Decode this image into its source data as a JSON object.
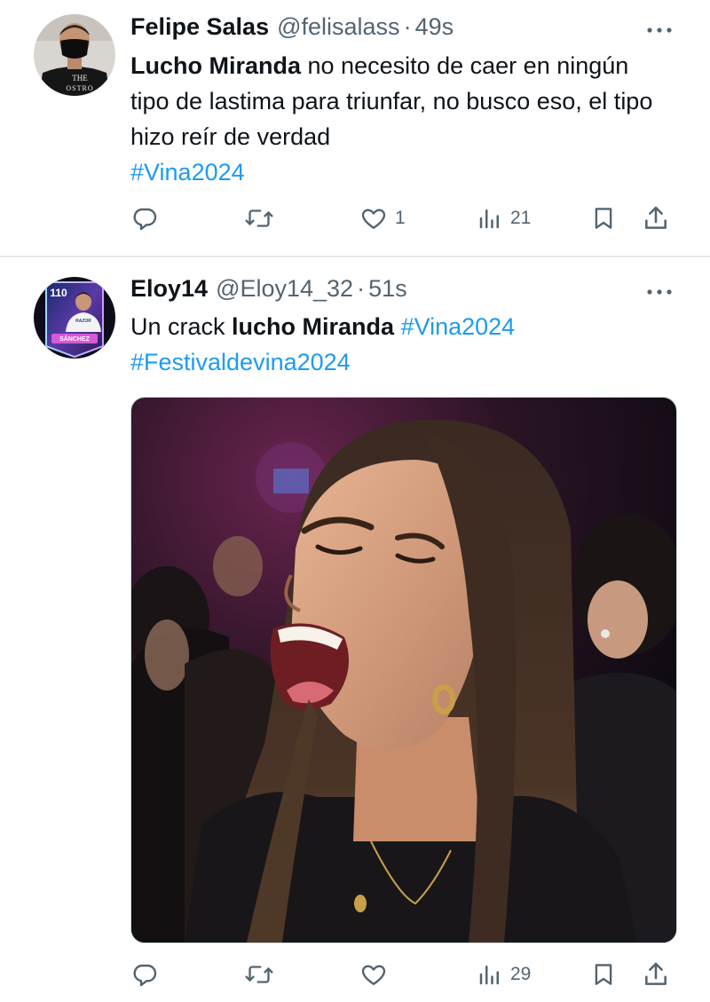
{
  "colors": {
    "text": "#0f1419",
    "secondary": "#536471",
    "link": "#1d9bf0",
    "divider": "#e7e9ea"
  },
  "tweets": [
    {
      "author_name": "Felipe Salas",
      "handle": "@felisalass",
      "separator": "·",
      "time": "49s",
      "avatar_text": "THE OSTRO",
      "text_parts": {
        "mention": "Lucho Miranda",
        "body": " no necesito de caer en ningún tipo de lastima para triunfar,  no busco eso, el tipo hizo reír de verdad",
        "hashtag": "#Vina2024"
      },
      "actions": {
        "reply_icon": "reply-icon",
        "retweet_icon": "retweet-icon",
        "like_icon": "heart-icon",
        "like_count": "1",
        "views_icon": "views-icon",
        "views_count": "21",
        "bookmark_icon": "bookmark-icon",
        "share_icon": "share-icon"
      }
    },
    {
      "author_name": "Eloy14",
      "handle": "@Eloy14_32",
      "separator": "·",
      "time": "51s",
      "avatar_rating": "110",
      "avatar_player": "SÁNCHEZ",
      "avatar_sponsor": "RAZOR",
      "text_parts": {
        "prefix": "Un crack ",
        "mention": "lucho Miranda",
        "hashtag1": "#Vina2024",
        "hashtag2": "#Festivaldevina2024"
      },
      "media": "photo of a young woman laughing in a concert audience",
      "actions": {
        "reply_icon": "reply-icon",
        "retweet_icon": "retweet-icon",
        "like_icon": "heart-icon",
        "like_count": "",
        "views_icon": "views-icon",
        "views_count": "29",
        "bookmark_icon": "bookmark-icon",
        "share_icon": "share-icon"
      }
    }
  ]
}
